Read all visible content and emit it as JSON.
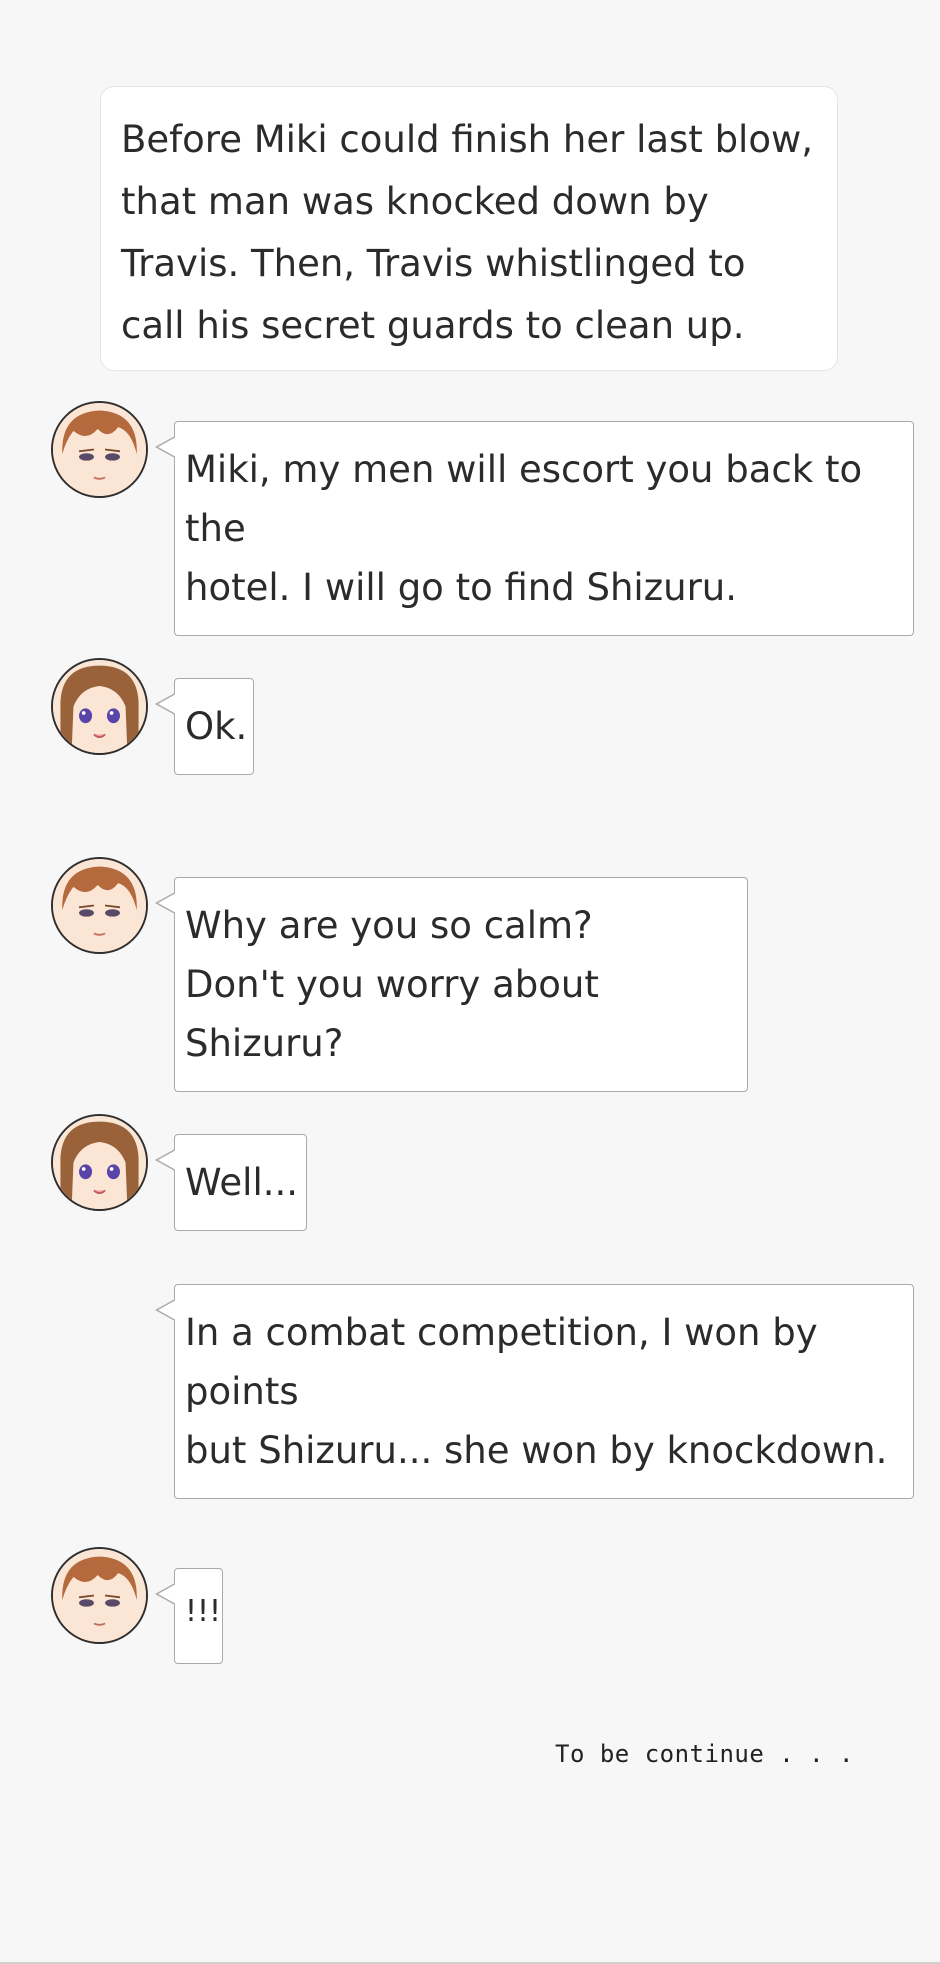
{
  "narration": {
    "text": "Before Miki could finish her last blow,\nthat man was knocked down by\nTravis. Then, Travis whistlinged to\ncall his secret guards to clean up."
  },
  "messages": [
    {
      "speaker_icon": "travis-avatar-icon",
      "text": "Miki, my men will escort you back to the\nhotel. I will go to find Shizuru."
    },
    {
      "speaker_icon": "miki-avatar-icon",
      "text": "Ok."
    },
    {
      "speaker_icon": "travis-avatar-icon",
      "text": "Why are you so calm?\nDon't you worry about Shizuru?"
    },
    {
      "speaker_icon": "miki-avatar-icon",
      "text": "Well..."
    },
    {
      "speaker_icon": "",
      "text": "In a combat competition, I won by points\nbut Shizuru... she won by knockdown."
    },
    {
      "speaker_icon": "travis-avatar-icon",
      "text": "!!!"
    }
  ],
  "footer": {
    "end_text": "To be continue . . ."
  },
  "colors": {
    "background": "#f7f7f7",
    "bubble_border": "#a9a9a9",
    "travis_hair": "#b46a3c",
    "miki_hair": "#9a6238"
  }
}
